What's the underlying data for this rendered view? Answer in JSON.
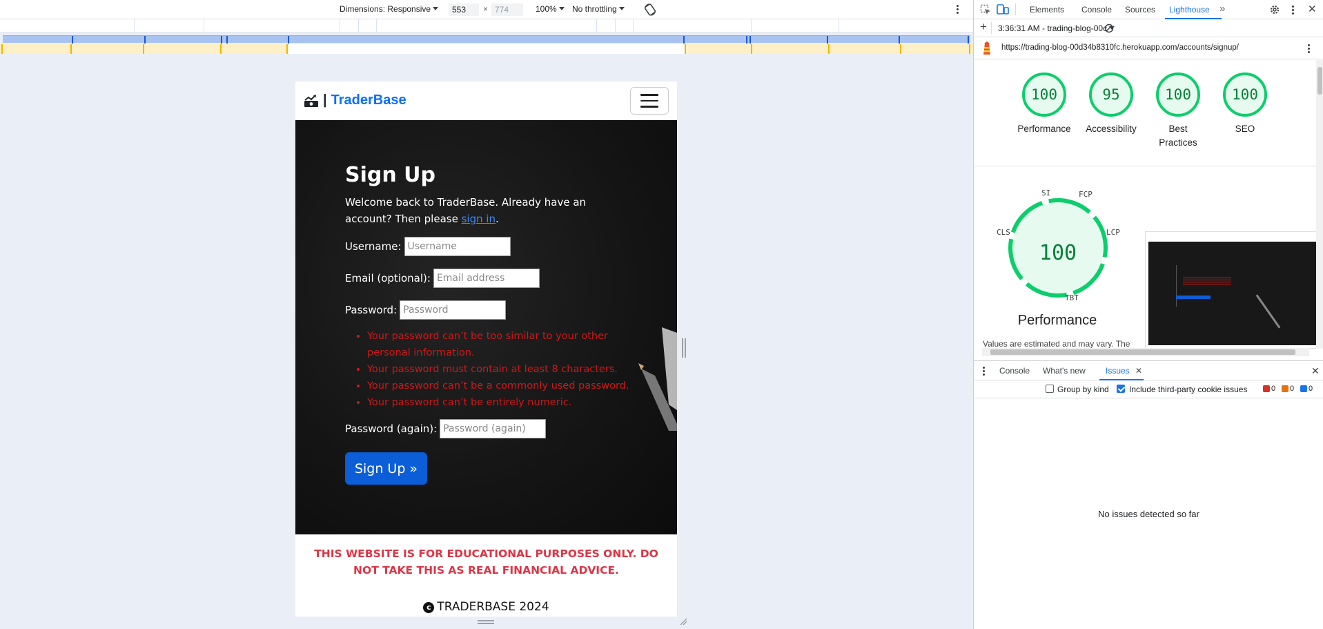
{
  "emulation": {
    "dimensions_label": "Dimensions: Responsive",
    "width": "553",
    "height": "774",
    "zoom": "100%",
    "throttling": "No throttling"
  },
  "site": {
    "brand_sep": "|",
    "brand_name": "TraderBase",
    "form_title": "Sign Up",
    "intro_text": "Welcome back to TraderBase. Already have an account? Then please ",
    "intro_link": "sign in",
    "intro_end": ".",
    "fields": {
      "username_label": "Username:",
      "username_placeholder": "Username",
      "email_label": "Email (optional):",
      "email_placeholder": "Email address",
      "password_label": "Password:",
      "password_placeholder": "Password",
      "password2_label": "Password (again):",
      "password2_placeholder": "Password (again)"
    },
    "password_rules": [
      "Your password can’t be too similar to your other personal information.",
      "Your password must contain at least 8 characters.",
      "Your password can’t be a commonly used password.",
      "Your password can’t be entirely numeric."
    ],
    "submit_label": "Sign Up »",
    "disclaimer": "THIS WEBSITE IS FOR EDUCATIONAL PURPOSES ONLY. DO NOT TAKE THIS AS REAL FINANCIAL ADVICE.",
    "copyright_symbol": "c",
    "copyright": "TRADERBASE 2024"
  },
  "devtools": {
    "tabs": [
      "Elements",
      "Console",
      "Sources",
      "Lighthouse"
    ],
    "active_tab": "Lighthouse",
    "report_selector": "3:36:31 AM - trading-blog-00c",
    "url": "https://trading-blog-00d34b8310fc.herokuapp.com/accounts/signup/",
    "scores": [
      {
        "value": "100",
        "label": "Performance"
      },
      {
        "value": "95",
        "label": "Accessibility"
      },
      {
        "value": "100",
        "label": "Best Practices"
      },
      {
        "value": "100",
        "label": "SEO"
      }
    ],
    "perf_score": "100",
    "metric_labels": {
      "si": "SI",
      "fcp": "FCP",
      "lcp": "LCP",
      "tbt": "TBT",
      "cls": "CLS"
    },
    "perf_title": "Performance",
    "values_note": "Values are estimated and may vary. The",
    "drawer_tabs": [
      "Console",
      "What's new",
      "Issues"
    ],
    "issues_group": "Group by kind",
    "issues_third_party": "Include third-party cookie issues",
    "issue_counts": {
      "errors": "0",
      "warnings": "0",
      "info": "0"
    },
    "no_issues": "No issues detected so far"
  },
  "colors": {
    "brand": "#0d6efd",
    "error": "#d01818",
    "disclaimer": "#dc3545",
    "score_green": "#0cce6b",
    "devtools_accent": "#1a73e8"
  }
}
